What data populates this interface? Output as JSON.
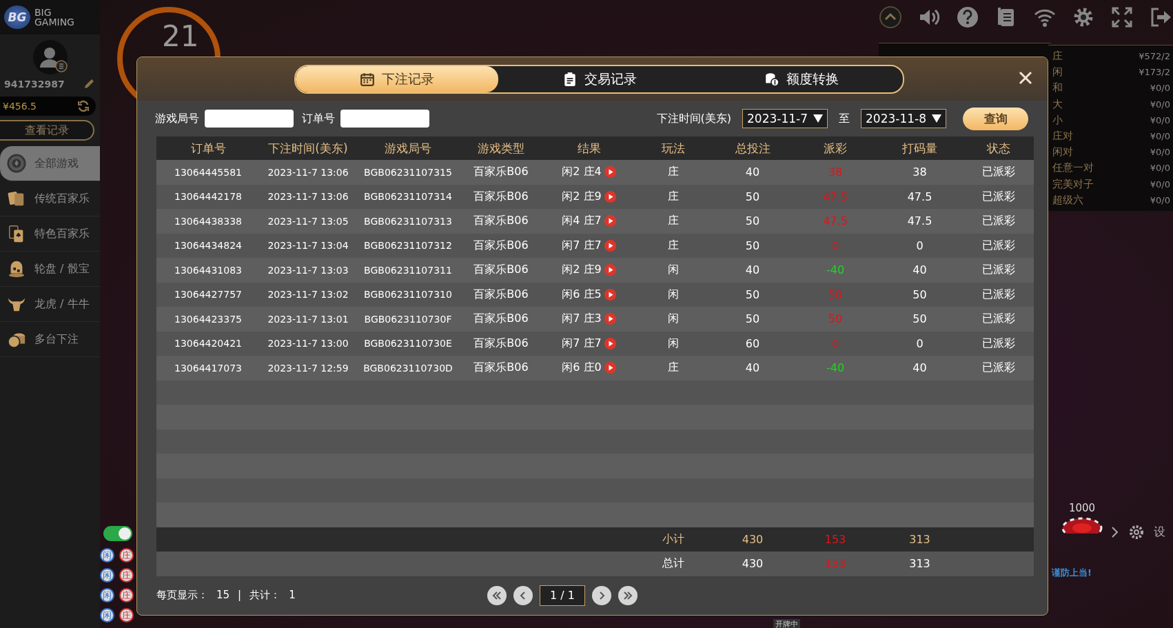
{
  "brand": {
    "badge": "BG",
    "line1": "BIG",
    "line2": "GAMING"
  },
  "timer": "21",
  "player": {
    "id": "941732987",
    "balance": "¥456.5",
    "history_button": "查看记录"
  },
  "nav": [
    {
      "label": "全部游戏",
      "selected": true,
      "kind": "chip"
    },
    {
      "label": "传统百家乐",
      "selected": false,
      "kind": "cards"
    },
    {
      "label": "特色百家乐",
      "selected": false,
      "kind": "card-spade"
    },
    {
      "label": "轮盘 / 骰宝",
      "selected": false,
      "kind": "dice"
    },
    {
      "label": "龙虎 / 牛牛",
      "selected": false,
      "kind": "bull"
    },
    {
      "label": "多台下注",
      "selected": false,
      "kind": "chips"
    }
  ],
  "limits": [
    {
      "label": "庄",
      "value": "¥572/2"
    },
    {
      "label": "闲",
      "value": "¥173/2"
    },
    {
      "label": "和",
      "value": "¥0/0"
    },
    {
      "label": "大",
      "value": "¥0/0"
    },
    {
      "label": "小",
      "value": "¥0/0"
    },
    {
      "label": "庄对",
      "value": "¥0/0"
    },
    {
      "label": "闲对",
      "value": "¥0/0"
    },
    {
      "label": "任意一对",
      "value": "¥0/0"
    },
    {
      "label": "完美对子",
      "value": "¥0/0"
    },
    {
      "label": "超级六",
      "value": "¥0/0"
    }
  ],
  "road": [
    {
      "text": "闲",
      "color": "#2f6fd0"
    },
    {
      "text": "庄",
      "color": "#d03030"
    },
    {
      "text": "闲",
      "color": "#2f6fd0"
    },
    {
      "text": "庄",
      "color": "#d03030"
    },
    {
      "text": "闲",
      "color": "#2f6fd0"
    },
    {
      "text": "庄",
      "color": "#d03030"
    },
    {
      "text": "闲",
      "color": "#2f6fd0"
    },
    {
      "text": "庄",
      "color": "#d03030"
    }
  ],
  "toggle": {
    "on": true
  },
  "chip": "1000",
  "settings_label": "设",
  "warning": "谨防上当!",
  "dealing_status": "开牌中",
  "modal": {
    "tabs": [
      {
        "label": "下注记录",
        "selected": true,
        "kind": "calendar"
      },
      {
        "label": "交易记录",
        "selected": false,
        "kind": "clipboard"
      },
      {
        "label": "额度转换",
        "selected": false,
        "kind": "coins"
      }
    ],
    "filters": {
      "round_label": "游戏局号",
      "order_label": "订单号",
      "time_label": "下注时间(美东)",
      "date_from": "2023-11-7",
      "to_label": "至",
      "date_to": "2023-11-8",
      "query_button": "查询"
    },
    "columns": [
      "订单号",
      "下注时间(美东)",
      "游戏局号",
      "游戏类型",
      "结果",
      "玩法",
      "总投注",
      "派彩",
      "打码量",
      "状态"
    ],
    "rows": [
      {
        "order": "13064445581",
        "time": "2023-11-7 13:06",
        "round": "BGB06231107315",
        "game": "百家乐B06",
        "result": "闲2 庄4",
        "bet_on": "庄",
        "stake": "40",
        "payout": {
          "text": "38",
          "color": "#e0141a"
        },
        "turnover": "38",
        "status": "已派彩"
      },
      {
        "order": "13064442178",
        "time": "2023-11-7 13:06",
        "round": "BGB06231107314",
        "game": "百家乐B06",
        "result": "闲2 庄9",
        "bet_on": "庄",
        "stake": "50",
        "payout": {
          "text": "47.5",
          "color": "#e0141a"
        },
        "turnover": "47.5",
        "status": "已派彩"
      },
      {
        "order": "13064438338",
        "time": "2023-11-7 13:05",
        "round": "BGB06231107313",
        "game": "百家乐B06",
        "result": "闲4 庄7",
        "bet_on": "庄",
        "stake": "50",
        "payout": {
          "text": "47.5",
          "color": "#e0141a"
        },
        "turnover": "47.5",
        "status": "已派彩"
      },
      {
        "order": "13064434824",
        "time": "2023-11-7 13:04",
        "round": "BGB06231107312",
        "game": "百家乐B06",
        "result": "闲7 庄7",
        "bet_on": "庄",
        "stake": "50",
        "payout": {
          "text": "0",
          "color": "#e0141a"
        },
        "turnover": "0",
        "status": "已派彩"
      },
      {
        "order": "13064431083",
        "time": "2023-11-7 13:03",
        "round": "BGB06231107311",
        "game": "百家乐B06",
        "result": "闲2 庄9",
        "bet_on": "闲",
        "stake": "40",
        "payout": {
          "text": "-40",
          "color": "#22d422"
        },
        "turnover": "40",
        "status": "已派彩"
      },
      {
        "order": "13064427757",
        "time": "2023-11-7 13:02",
        "round": "BGB06231107310",
        "game": "百家乐B06",
        "result": "闲6 庄5",
        "bet_on": "闲",
        "stake": "50",
        "payout": {
          "text": "50",
          "color": "#e0141a"
        },
        "turnover": "50",
        "status": "已派彩"
      },
      {
        "order": "13064423375",
        "time": "2023-11-7 13:01",
        "round": "BGB0623110730F",
        "game": "百家乐B06",
        "result": "闲7 庄3",
        "bet_on": "闲",
        "stake": "50",
        "payout": {
          "text": "50",
          "color": "#e0141a"
        },
        "turnover": "50",
        "status": "已派彩"
      },
      {
        "order": "13064420421",
        "time": "2023-11-7 13:00",
        "round": "BGB0623110730E",
        "game": "百家乐B06",
        "result": "闲7 庄7",
        "bet_on": "闲",
        "stake": "60",
        "payout": {
          "text": "0",
          "color": "#e0141a"
        },
        "turnover": "0",
        "status": "已派彩"
      },
      {
        "order": "13064417073",
        "time": "2023-11-7 12:59",
        "round": "BGB0623110730D",
        "game": "百家乐B06",
        "result": "闲6 庄0",
        "bet_on": "庄",
        "stake": "40",
        "payout": {
          "text": "-40",
          "color": "#22d422"
        },
        "turnover": "40",
        "status": "已派彩"
      }
    ],
    "summary": [
      {
        "kind": "subtotal",
        "label": "小计",
        "stake": "430",
        "payout": {
          "text": "153",
          "color": "#e0141a"
        },
        "turnover": "313"
      },
      {
        "kind": "total",
        "label": "总计",
        "stake": "430",
        "payout": {
          "text": "153",
          "color": "#e0141a"
        },
        "turnover": "313"
      }
    ],
    "footer": {
      "per_page_label": "每页显示：",
      "per_page": "15",
      "separator": "|",
      "count_label": "共计：",
      "count": "1",
      "page": "1 / 1"
    }
  }
}
